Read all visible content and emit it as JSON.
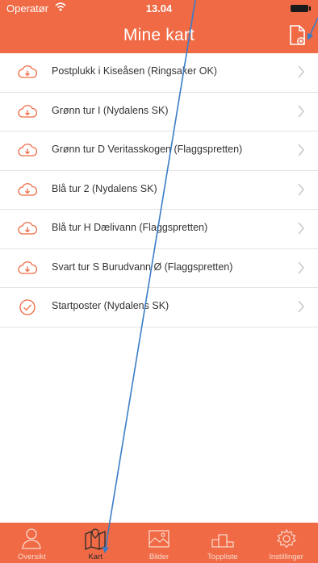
{
  "status_bar": {
    "carrier": "Operatør",
    "time": "13.04"
  },
  "nav": {
    "title": "Mine kart",
    "add_icon": "add-map-file-icon"
  },
  "maps": [
    {
      "name": "Postplukk i Kiseåsen (Ringsaker OK)",
      "status": "download"
    },
    {
      "name": "Grønn tur I (Nydalens SK)",
      "status": "download"
    },
    {
      "name": "Grønn tur D Veritasskogen (Flaggspretten)",
      "status": "download"
    },
    {
      "name": "Blå tur 2 (Nydalens SK)",
      "status": "download"
    },
    {
      "name": "Blå tur H Dælivann (Flaggspretten)",
      "status": "download"
    },
    {
      "name": "Svart tur S Burudvann Ø (Flaggspretten)",
      "status": "download"
    },
    {
      "name": "Startposter (Nydalens SK)",
      "status": "downloaded"
    }
  ],
  "tabs": [
    {
      "label": "Oversikt",
      "icon": "person-icon"
    },
    {
      "label": "Kart",
      "icon": "map-icon",
      "active": true
    },
    {
      "label": "Bilder",
      "icon": "image-icon"
    },
    {
      "label": "Toppliste",
      "icon": "podium-icon"
    },
    {
      "label": "Instillinger",
      "icon": "gear-icon"
    }
  ],
  "colors": {
    "accent": "#ef6a45",
    "active_tab": "#2b2b2b",
    "annotation_arrow": "#3a7dc6"
  }
}
